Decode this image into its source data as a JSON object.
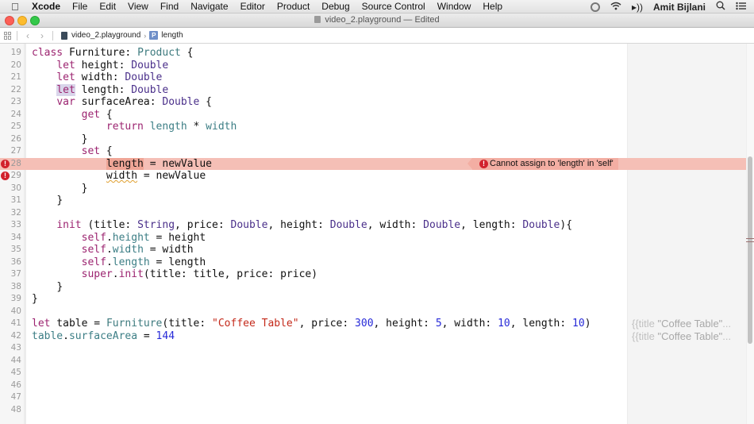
{
  "menubar": {
    "app_name": "Xcode",
    "items": [
      "File",
      "Edit",
      "View",
      "Find",
      "Navigate",
      "Editor",
      "Product",
      "Debug",
      "Source Control",
      "Window",
      "Help"
    ],
    "user": "Amit Bijlani"
  },
  "window": {
    "title": "video_2.playground — Edited"
  },
  "jumpbar": {
    "file": "video_2.playground",
    "symbol": "length",
    "symbol_badge": "P"
  },
  "editor": {
    "lines": [
      {
        "n": "19"
      },
      {
        "n": "20"
      },
      {
        "n": "21"
      },
      {
        "n": "22"
      },
      {
        "n": "23"
      },
      {
        "n": "24"
      },
      {
        "n": "25"
      },
      {
        "n": "26"
      },
      {
        "n": "27"
      },
      {
        "n": "28"
      },
      {
        "n": "29"
      },
      {
        "n": "30"
      },
      {
        "n": "31"
      },
      {
        "n": "32"
      },
      {
        "n": "33"
      },
      {
        "n": "34"
      },
      {
        "n": "35"
      },
      {
        "n": "36"
      },
      {
        "n": "37"
      },
      {
        "n": "38"
      },
      {
        "n": "39"
      },
      {
        "n": "40"
      },
      {
        "n": "41"
      },
      {
        "n": "42"
      },
      {
        "n": "43"
      },
      {
        "n": "44"
      },
      {
        "n": "45"
      },
      {
        "n": "46"
      },
      {
        "n": "47"
      },
      {
        "n": "48"
      }
    ],
    "code": {
      "l19": [
        "class",
        " Furniture: ",
        "Product",
        " {"
      ],
      "l20": [
        "let",
        " height: ",
        "Double"
      ],
      "l21": [
        "let",
        " width: ",
        "Double"
      ],
      "l22": [
        "let",
        " length: ",
        "Double"
      ],
      "l23": [
        "var",
        " surfaceArea: ",
        "Double",
        " {"
      ],
      "l24": [
        "get",
        " {"
      ],
      "l25": [
        "return",
        " ",
        "length",
        " * ",
        "width"
      ],
      "l26": [
        "}"
      ],
      "l27": [
        "set",
        " {"
      ],
      "l28": [
        "length",
        " = newValue"
      ],
      "l29": [
        "width",
        " = newValue"
      ],
      "l30": [
        "}"
      ],
      "l31": [
        "}"
      ],
      "l33": [
        "init",
        " (title: ",
        "String",
        ", price: ",
        "Double",
        ", height: ",
        "Double",
        ", width: ",
        "Double",
        ", length: ",
        "Double",
        "){"
      ],
      "l34": [
        "self",
        ".",
        "height",
        " = height"
      ],
      "l35": [
        "self",
        ".",
        "width",
        " = width"
      ],
      "l36": [
        "self",
        ".",
        "length",
        " = length"
      ],
      "l37": [
        "super",
        ".",
        "init",
        "(title: title, price: price)"
      ],
      "l38": [
        "}"
      ],
      "l39": [
        "}"
      ],
      "l41": [
        "let",
        " table = ",
        "Furniture",
        "(title: ",
        "\"Coffee Table\"",
        ", price: ",
        "300",
        ", height: ",
        "5",
        ", width: ",
        "10",
        ", length: ",
        "10",
        ")"
      ],
      "l42": [
        "table",
        ".",
        "surfaceArea",
        " = ",
        "144"
      ]
    },
    "error_message": "Cannot assign to 'length' in 'self'",
    "error_badge": "!"
  },
  "results": [
    {
      "prefix": "{{title ",
      "value": "\"Coffee Table\"",
      "suffix": "..."
    },
    {
      "prefix": "{{title ",
      "value": "\"Coffee Table\"",
      "suffix": "..."
    }
  ]
}
